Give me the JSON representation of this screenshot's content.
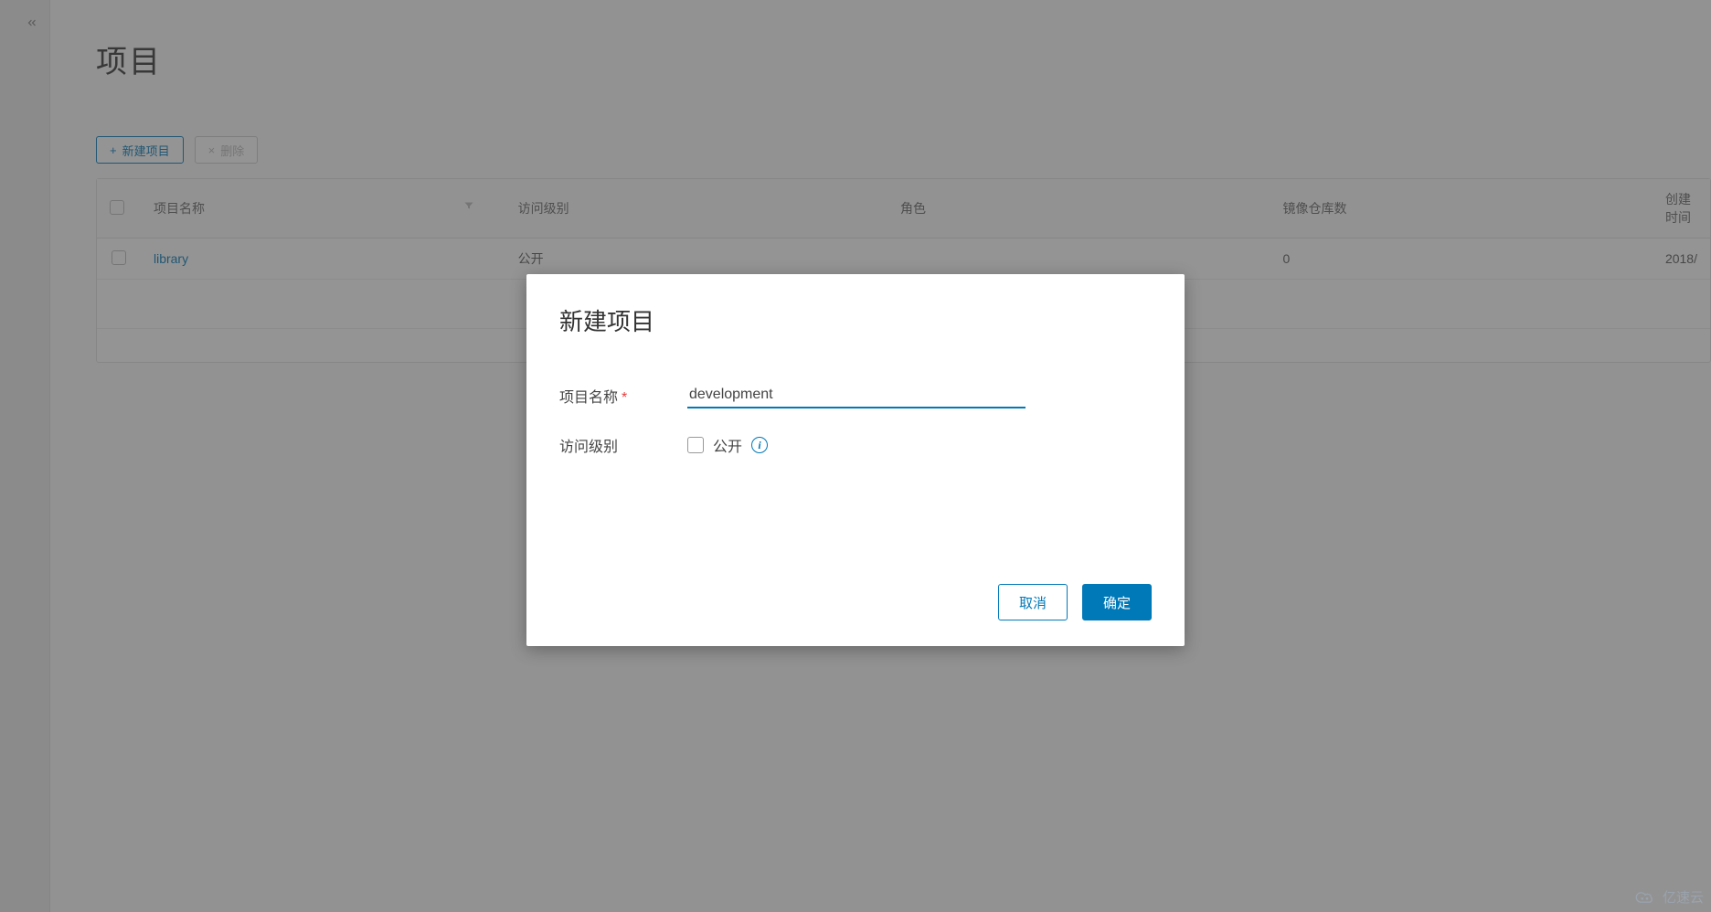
{
  "page": {
    "title": "项目"
  },
  "toolbar": {
    "new_project": "新建项目",
    "delete": "删除"
  },
  "table": {
    "headers": {
      "name": "项目名称",
      "access": "访问级别",
      "role": "角色",
      "repos": "镜像仓库数",
      "created": "创建时间"
    },
    "rows": [
      {
        "name": "library",
        "access": "公开",
        "role": "",
        "repos": "0",
        "created": "2018/"
      }
    ]
  },
  "modal": {
    "title": "新建项目",
    "labels": {
      "project_name": "项目名称",
      "access_level": "访问级别",
      "public": "公开"
    },
    "name_value": "development",
    "buttons": {
      "cancel": "取消",
      "confirm": "确定"
    }
  },
  "watermark": "亿速云"
}
